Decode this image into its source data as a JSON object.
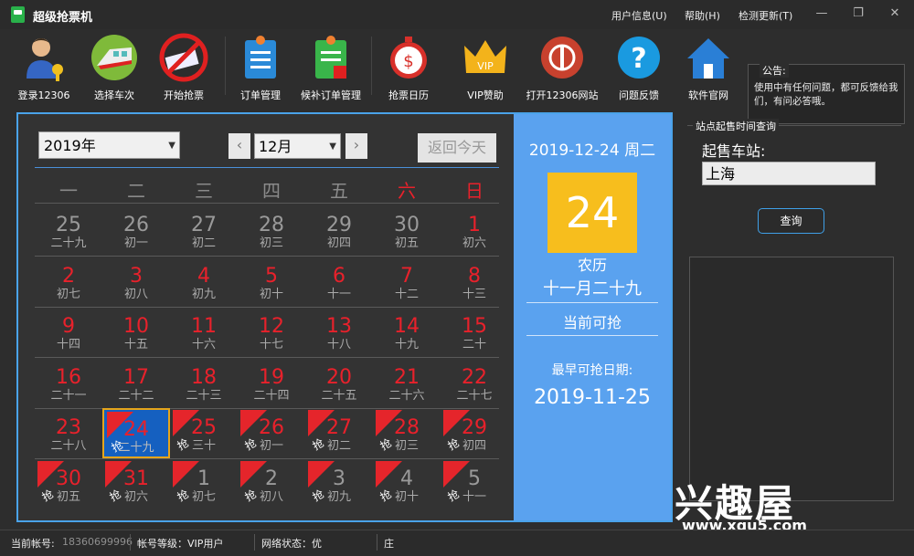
{
  "window": {
    "title": "超级抢票机",
    "menu": [
      "用户信息(U)",
      "帮助(H)",
      "检测更新(T)"
    ]
  },
  "toolbar": {
    "items": [
      {
        "label": "登录12306",
        "icon": "user-login-icon"
      },
      {
        "label": "选择车次",
        "icon": "train-icon"
      },
      {
        "label": "开始抢票",
        "icon": "ticket-icon"
      },
      {
        "label": "订单管理",
        "icon": "order-icon"
      },
      {
        "label": "候补订单管理",
        "icon": "waitlist-order-icon"
      },
      {
        "label": "抢票日历",
        "icon": "stopwatch-icon"
      },
      {
        "label": "VIP赞助",
        "icon": "vip-crown-icon"
      },
      {
        "label": "打开12306网站",
        "icon": "railway-logo-icon"
      },
      {
        "label": "问题反馈",
        "icon": "question-icon"
      },
      {
        "label": "软件官网",
        "icon": "home-icon"
      }
    ]
  },
  "notice": {
    "title": "公告:",
    "text": "使用中有任何问题，都可反馈给我们，有问必答哦。"
  },
  "calendar": {
    "year": "2019年",
    "month": "12月",
    "today_btn": "返回今天",
    "weekdays": [
      "一",
      "二",
      "三",
      "四",
      "五",
      "六",
      "日"
    ],
    "grab_tag": "抢",
    "rows": [
      [
        {
          "d": "25",
          "l": "二十九",
          "c": "grey"
        },
        {
          "d": "26",
          "l": "初一",
          "c": "grey"
        },
        {
          "d": "27",
          "l": "初二",
          "c": "grey"
        },
        {
          "d": "28",
          "l": "初三",
          "c": "grey"
        },
        {
          "d": "29",
          "l": "初四",
          "c": "grey"
        },
        {
          "d": "30",
          "l": "初五",
          "c": "grey"
        },
        {
          "d": "1",
          "l": "初六",
          "c": "red"
        }
      ],
      [
        {
          "d": "2",
          "l": "初七",
          "c": "red"
        },
        {
          "d": "3",
          "l": "初八",
          "c": "red"
        },
        {
          "d": "4",
          "l": "初九",
          "c": "red"
        },
        {
          "d": "5",
          "l": "初十",
          "c": "red"
        },
        {
          "d": "6",
          "l": "十一",
          "c": "red"
        },
        {
          "d": "7",
          "l": "十二",
          "c": "red"
        },
        {
          "d": "8",
          "l": "十三",
          "c": "red"
        }
      ],
      [
        {
          "d": "9",
          "l": "十四",
          "c": "red"
        },
        {
          "d": "10",
          "l": "十五",
          "c": "red"
        },
        {
          "d": "11",
          "l": "十六",
          "c": "red"
        },
        {
          "d": "12",
          "l": "十七",
          "c": "red"
        },
        {
          "d": "13",
          "l": "十八",
          "c": "red"
        },
        {
          "d": "14",
          "l": "十九",
          "c": "red"
        },
        {
          "d": "15",
          "l": "二十",
          "c": "red"
        }
      ],
      [
        {
          "d": "16",
          "l": "二十一",
          "c": "red"
        },
        {
          "d": "17",
          "l": "二十二",
          "c": "red"
        },
        {
          "d": "18",
          "l": "二十三",
          "c": "red"
        },
        {
          "d": "19",
          "l": "二十四",
          "c": "red"
        },
        {
          "d": "20",
          "l": "二十五",
          "c": "red"
        },
        {
          "d": "21",
          "l": "二十六",
          "c": "red"
        },
        {
          "d": "22",
          "l": "二十七",
          "c": "red"
        }
      ],
      [
        {
          "d": "23",
          "l": "二十八",
          "c": "red"
        },
        {
          "d": "24",
          "l": "二十九",
          "c": "red",
          "sel": true,
          "tag": true
        },
        {
          "d": "25",
          "l": "三十",
          "c": "red",
          "tag": true
        },
        {
          "d": "26",
          "l": "初一",
          "c": "red",
          "tag": true
        },
        {
          "d": "27",
          "l": "初二",
          "c": "red",
          "tag": true
        },
        {
          "d": "28",
          "l": "初三",
          "c": "red",
          "tag": true
        },
        {
          "d": "29",
          "l": "初四",
          "c": "red",
          "tag": true
        }
      ],
      [
        {
          "d": "30",
          "l": "初五",
          "c": "red",
          "tag": true
        },
        {
          "d": "31",
          "l": "初六",
          "c": "red",
          "tag": true
        },
        {
          "d": "1",
          "l": "初七",
          "c": "grey",
          "tag": true
        },
        {
          "d": "2",
          "l": "初八",
          "c": "grey",
          "tag": true
        },
        {
          "d": "3",
          "l": "初九",
          "c": "grey",
          "tag": true
        },
        {
          "d": "4",
          "l": "初十",
          "c": "grey",
          "tag": true
        },
        {
          "d": "5",
          "l": "十一",
          "c": "grey",
          "tag": true
        }
      ]
    ]
  },
  "detail": {
    "date": "2019-12-24 周二",
    "day": "24",
    "lunar_label": "农历",
    "lunar_date": "十一月二十九",
    "status": "当前可抢",
    "earliest_label": "最早可抢日期:",
    "earliest_date": "2019-11-25"
  },
  "station": {
    "group_title": "站点起售时间查询",
    "label": "起售车站:",
    "value": "上海",
    "query_btn": "查询"
  },
  "status": {
    "account_label": "当前帐号:",
    "account_value": "18360699996",
    "level": "帐号等级：VIP用户",
    "network": "网络状态：优",
    "extra": "庄"
  },
  "watermark": {
    "logo": "兴趣屋",
    "url": "www.xqu5.com"
  }
}
